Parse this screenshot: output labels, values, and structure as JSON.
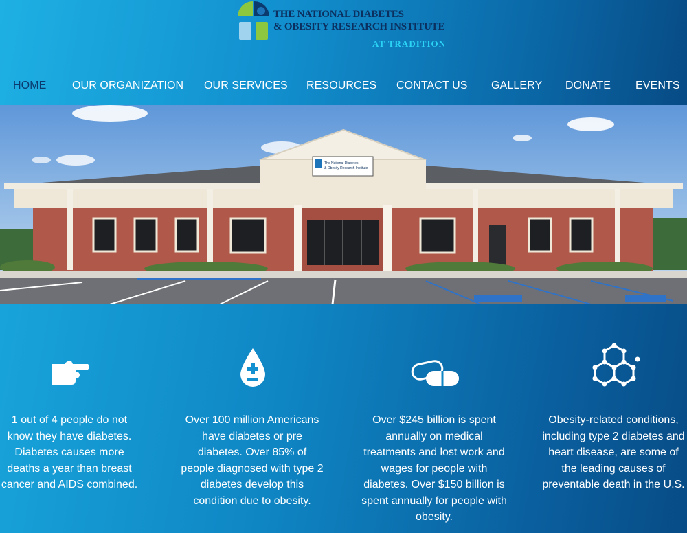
{
  "logo": {
    "line1": "The National Diabetes",
    "line2": "& Obesity Research Institute",
    "sub": "at Tradition",
    "colors": {
      "navy": "#0b2f5e",
      "green": "#8dc63f",
      "lightblue": "#9fd3ee",
      "blue": "#1e74b9"
    }
  },
  "nav": {
    "items": [
      {
        "label": "HOME",
        "active": true
      },
      {
        "label": "OUR ORGANIZATION"
      },
      {
        "label": "OUR SERVICES"
      },
      {
        "label": "RESOURCES"
      },
      {
        "label": "CONTACT US"
      },
      {
        "label": "GALLERY"
      },
      {
        "label": "DONATE"
      },
      {
        "label": "EVENTS"
      }
    ]
  },
  "hero": {
    "sign_line1": "The National Diabetes",
    "sign_line2": "& Obesity Research Institute"
  },
  "stats": [
    {
      "icon": "pointing-hand-icon",
      "text": "1 out of 4 people do not know they have diabetes. Diabetes causes more deaths a year than breast cancer and AIDS combined."
    },
    {
      "icon": "blood-drop-icon",
      "text": "Over 100 million Americans have diabetes or pre diabetes. Over 85% of people diagnosed with type 2 diabetes develop this condition due to obesity."
    },
    {
      "icon": "pill-capsule-icon",
      "text": "Over $245 billion is spent annually on medical treatments and lost work and wages for people with diabetes. Over $150 billion is spent annually for people with obesity."
    },
    {
      "icon": "molecule-icon",
      "text": "Obesity-related conditions, including type 2 diabetes and heart disease, are some of the leading causes of preventable death in the U.S."
    }
  ]
}
